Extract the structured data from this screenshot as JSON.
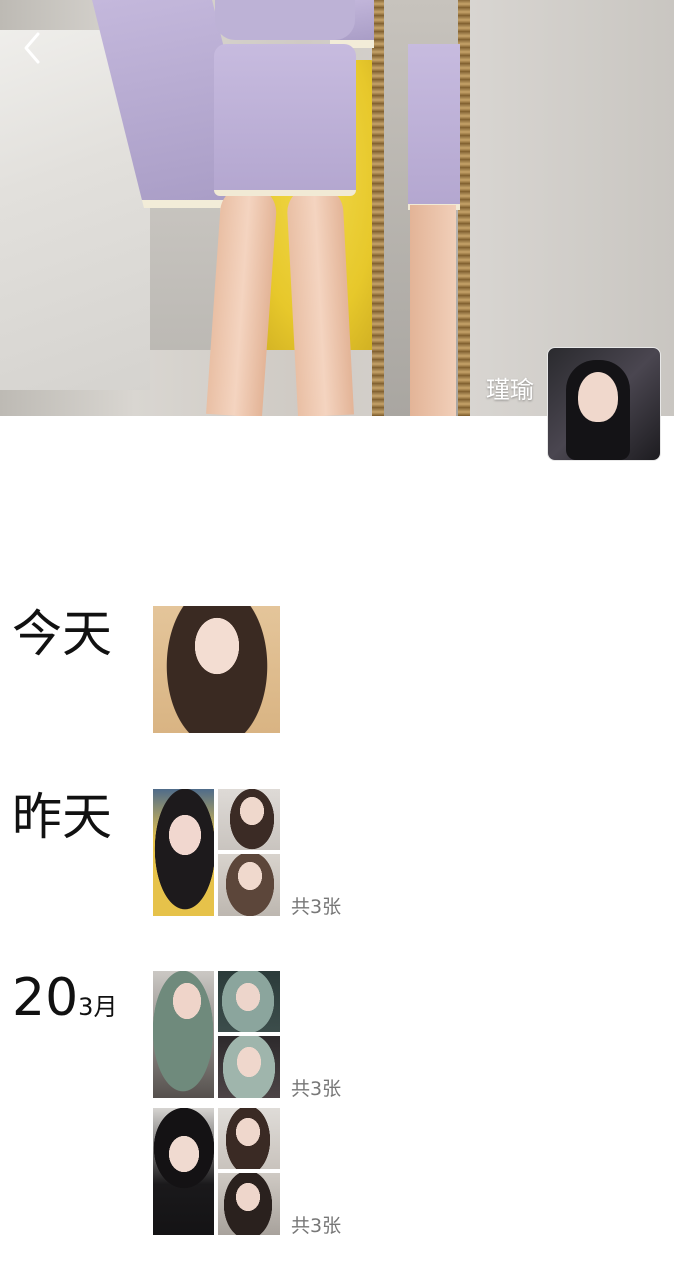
{
  "header": {
    "back_icon": "chevron-left-icon",
    "profile_name": "瑾瑜"
  },
  "timeline": {
    "today": {
      "label": "今天",
      "photo_count": null
    },
    "yesterday": {
      "label": "昨天",
      "photo_count": "共3张"
    },
    "march20": {
      "day": "20",
      "month": "3月",
      "groups": [
        {
          "photo_count": "共3张"
        },
        {
          "photo_count": "共3张"
        }
      ]
    }
  },
  "colors": {
    "background": "#ffffff",
    "label_text": "#111111",
    "count_text": "#777777",
    "overlay_text": "#ffffff"
  }
}
